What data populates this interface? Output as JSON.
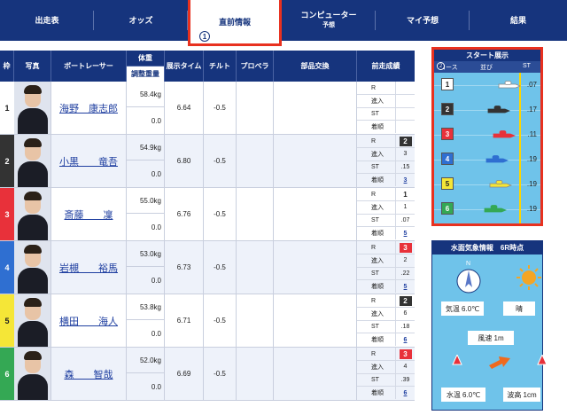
{
  "nav": {
    "items": [
      "出走表",
      "オッズ",
      "直前情報",
      "コンピューター",
      "マイ予想",
      "結果"
    ],
    "computer_sub": "予想",
    "active_index": 2,
    "active_badge": "1"
  },
  "table": {
    "headers": {
      "waku": "枠",
      "photo": "写真",
      "racer": "ボートレーサー",
      "weight": "体重",
      "weight_adjust": "調整重量",
      "exhibit_time": "展示タイム",
      "tilt": "チルト",
      "propeller": "プロペラ",
      "parts": "部品交換",
      "recent": "前走成績"
    },
    "recent_labels": [
      "R",
      "進入",
      "ST",
      "着順"
    ],
    "rows": [
      {
        "waku": "1",
        "name": "海野　康志郎",
        "weight": "58.4kg",
        "adjust": "0.0",
        "time": "6.64",
        "tilt": "-0.5",
        "r": "",
        "entry": "",
        "st": "",
        "rank": ""
      },
      {
        "waku": "2",
        "name": "小黒　　竜吾",
        "weight": "54.9kg",
        "adjust": "0.0",
        "time": "6.80",
        "tilt": "-0.5",
        "r": "2",
        "entry": "3",
        "st": ".15",
        "rank": "3"
      },
      {
        "waku": "3",
        "name": "斎藤　　凜",
        "weight": "55.0kg",
        "adjust": "0.0",
        "time": "6.76",
        "tilt": "-0.5",
        "r": "1",
        "entry": "1",
        "st": ".07",
        "rank": "5"
      },
      {
        "waku": "4",
        "name": "岩槻　　裕馬",
        "weight": "53.0kg",
        "adjust": "0.0",
        "time": "6.73",
        "tilt": "-0.5",
        "r": "3",
        "entry": "2",
        "st": ".22",
        "rank": "5"
      },
      {
        "waku": "5",
        "name": "横田　　海人",
        "weight": "53.8kg",
        "adjust": "0.0",
        "time": "6.71",
        "tilt": "-0.5",
        "r": "2",
        "entry": "6",
        "st": ".18",
        "rank": "6"
      },
      {
        "waku": "6",
        "name": "森　　智哉",
        "weight": "52.0kg",
        "adjust": "0.0",
        "time": "6.69",
        "tilt": "-0.5",
        "r": "3",
        "entry": "4",
        "st": ".39",
        "rank": "6"
      }
    ]
  },
  "start_exhibit": {
    "title": "スタート展示",
    "col_course": "コース",
    "col_lineup": "並び",
    "col_st": "ST",
    "course_badge": "2",
    "entries": [
      {
        "course": "1",
        "st": ".07"
      },
      {
        "course": "2",
        "st": ".17"
      },
      {
        "course": "3",
        "st": ".11"
      },
      {
        "course": "4",
        "st": ".19"
      },
      {
        "course": "5",
        "st": ".19"
      },
      {
        "course": "6",
        "st": ".19"
      }
    ]
  },
  "weather": {
    "title": "水面気象情報　6R時点",
    "compass_label": "N",
    "temperature": "気温 6.0℃",
    "condition": "晴",
    "wind": "風速 1m",
    "water_temp": "水温 6.0℃",
    "wave": "波高 1cm"
  },
  "colors": {
    "navy": "#16347d",
    "highlight": "#e8311f",
    "waku": [
      "#ffffff",
      "#333333",
      "#e8313a",
      "#2f6fd1",
      "#f5e637",
      "#34a854"
    ]
  }
}
